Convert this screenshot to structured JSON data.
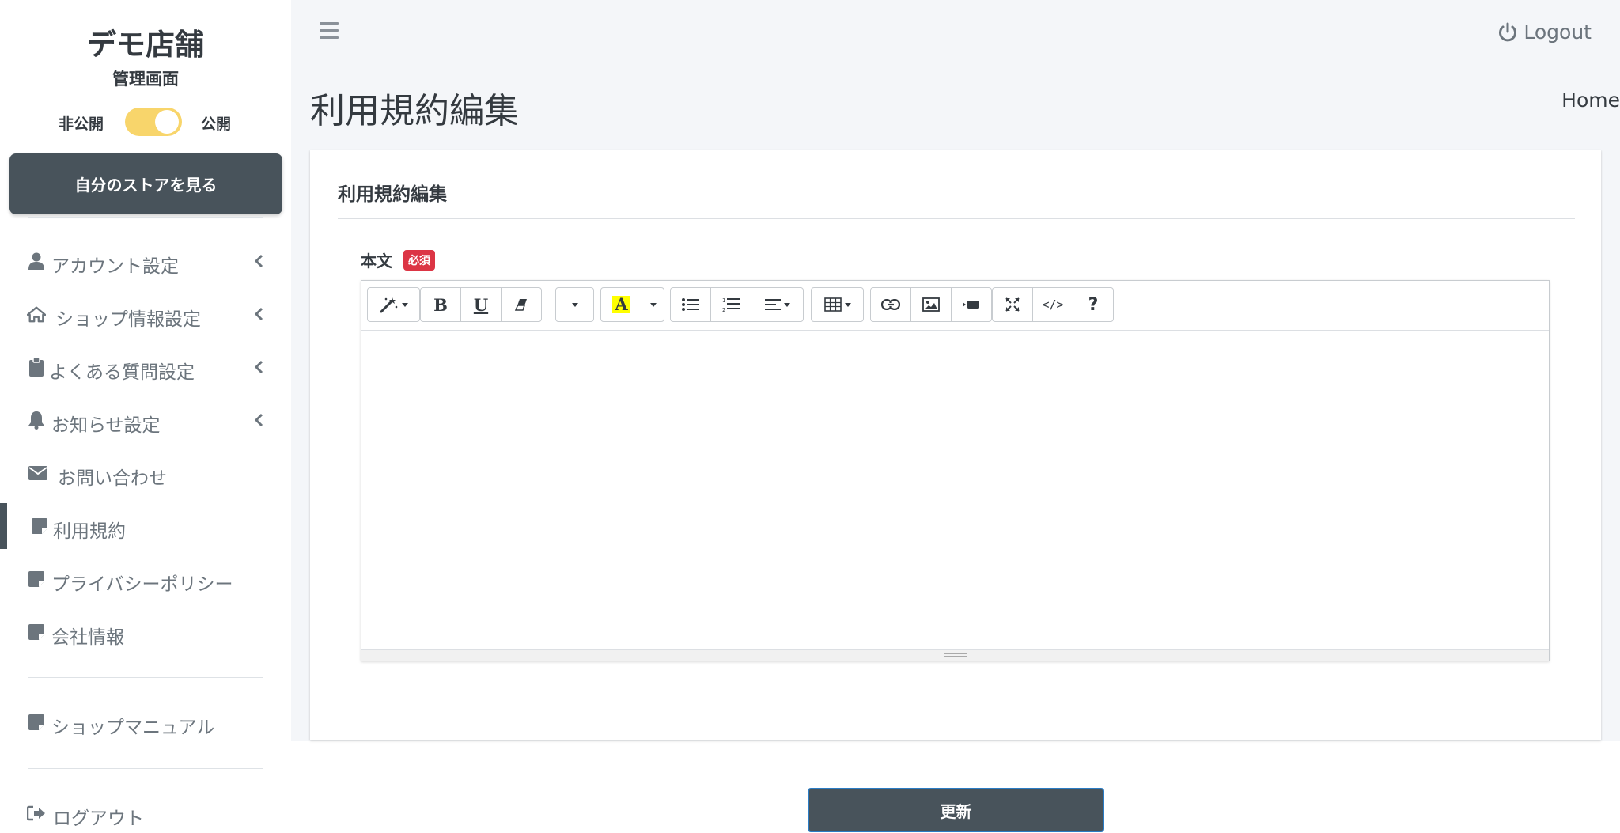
{
  "brand": {
    "name": "デモ店舗",
    "subtitle": "管理画面"
  },
  "publish_toggle": {
    "off_label": "非公開",
    "on_label": "公開",
    "state": "on"
  },
  "store_button": {
    "label": "自分のストアを見る"
  },
  "sidebar": {
    "items": [
      {
        "label": "アカウント設定",
        "icon": "user-icon",
        "expandable": true
      },
      {
        "label": "ショップ情報設定",
        "icon": "home-icon",
        "expandable": true
      },
      {
        "label": "よくある質問設定",
        "icon": "clipboard-icon",
        "expandable": true
      },
      {
        "label": "お知らせ設定",
        "icon": "bell-icon",
        "expandable": true
      },
      {
        "label": "お問い合わせ",
        "icon": "envelope-icon",
        "expandable": false
      },
      {
        "label": "利用規約",
        "icon": "note-icon",
        "expandable": false,
        "active": true
      },
      {
        "label": "プライバシーポリシー",
        "icon": "note-icon",
        "expandable": false
      },
      {
        "label": "会社情報",
        "icon": "note-icon",
        "expandable": false
      }
    ],
    "manual": {
      "label": "ショップマニュアル",
      "icon": "note-icon"
    },
    "logout": {
      "label": "ログアウト",
      "icon": "sign-out-icon"
    }
  },
  "topbar": {
    "logout_label": "Logout"
  },
  "page": {
    "title": "利用規約編集",
    "breadcrumb": "Home"
  },
  "card": {
    "title": "利用規約編集",
    "field_label": "本文",
    "required_badge": "必須"
  },
  "editor": {
    "toolbar": [
      "style-magic-icon",
      "bold-icon",
      "underline-icon",
      "eraser-icon",
      "font-dropdown-icon",
      "highlight-icon",
      "unordered-list-icon",
      "ordered-list-icon",
      "align-icon",
      "table-icon",
      "link-icon",
      "picture-icon",
      "video-icon",
      "fullscreen-icon",
      "code-view-icon",
      "help-icon"
    ],
    "bold_glyph": "B",
    "underline_glyph": "U",
    "highlight_glyph": "A",
    "code_glyph": "</>",
    "help_glyph": "?",
    "content": ""
  },
  "submit": {
    "label": "更新"
  },
  "colors": {
    "accent": "#48535b",
    "toggle": "#f8d56b",
    "required": "#dc3545",
    "highlight": "#ffff00"
  }
}
